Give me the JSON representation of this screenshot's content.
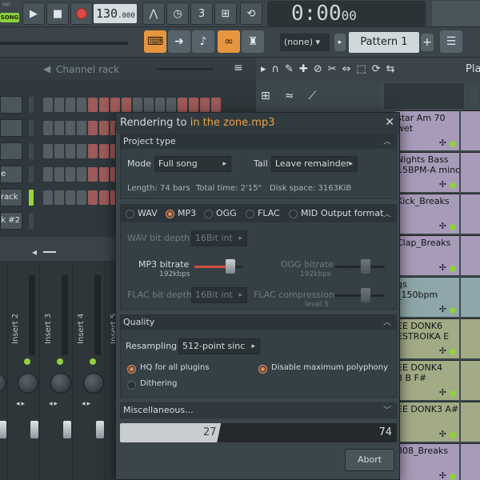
{
  "toolbar": {
    "pat_label": "PAT",
    "song_label": "SONG",
    "tempo_main": "130",
    "tempo_fraction": ".000",
    "time_main": "0:00",
    "time_fraction": "00",
    "snap_select": "(none)",
    "pattern_select": "Pattern 1"
  },
  "channel_rack": {
    "title": "Channel rack",
    "channels": [
      "",
      "",
      "",
      "e",
      "rack",
      "ck #2"
    ]
  },
  "playlist": {
    "title": "Pla",
    "clips": [
      {
        "text": "star Am 70\nwet",
        "color": "#a89bb9"
      },
      {
        "text": "Nights Bass\n15BPM-A mino…",
        "color": "#a89bb9"
      },
      {
        "text": "Kick_Breaks",
        "color": "#a89bb9"
      },
      {
        "text": "Clap_Breaks",
        "color": "#a89bb9"
      },
      {
        "text": "gs\n_150bpm",
        "color": "#8ea6a9"
      },
      {
        "text": "EE DONK6\nESTROIKA E",
        "color": "#a3ab86"
      },
      {
        "text": "EE DONK4\n3 B F#",
        "color": "#a3ab86"
      },
      {
        "text": "EE DONK3 A#",
        "color": "#a3ab86"
      },
      {
        "text": "808_Breaks",
        "color": "#a89bb9"
      }
    ]
  },
  "mixer": {
    "inserts": [
      "Insert 2",
      "Insert 3",
      "Insert 4",
      "Insert 5"
    ]
  },
  "dialog": {
    "title_prefix": "Rendering to ",
    "file_name": "in the zone.mp3",
    "project_type": {
      "header": "Project type",
      "mode_label": "Mode",
      "mode_value": "Full song",
      "tail_label": "Tail",
      "tail_value": "Leave remainder",
      "length": "Length: 74 bars",
      "total_time": "Total time: 2'15\"",
      "disk_space": "Disk space: 3163KiB"
    },
    "output_format": {
      "header": "Output format",
      "formats": [
        "WAV",
        "MP3",
        "OGG",
        "FLAC",
        "MID"
      ],
      "selected": "MP3",
      "wav_bit_depth_label": "WAV bit depth",
      "wav_bit_depth_value": "16Bit int",
      "mp3_bitrate_label": "MP3 bitrate",
      "mp3_bitrate_value": "192kbps",
      "mp3_bitrate_level": 0.75,
      "ogg_bitrate_label": "OGG bitrate",
      "ogg_bitrate_value": "192kbps",
      "flac_bit_depth_label": "FLAC bit depth",
      "flac_bit_depth_value": "16Bit int",
      "flac_compression_label": "FLAC compression",
      "flac_compression_value": "level 5"
    },
    "quality": {
      "header": "Quality",
      "resampling_label": "Resampling",
      "resampling_value": "512-point sinc",
      "hq_plugins": "HQ for all plugins",
      "disable_polyphony": "Disable maximum polyphony",
      "dithering": "Dithering"
    },
    "misc_header": "Miscellaneous...",
    "progress_current": "27",
    "progress_total": "74",
    "progress_fraction": 0.365,
    "abort_label": "Abort"
  }
}
